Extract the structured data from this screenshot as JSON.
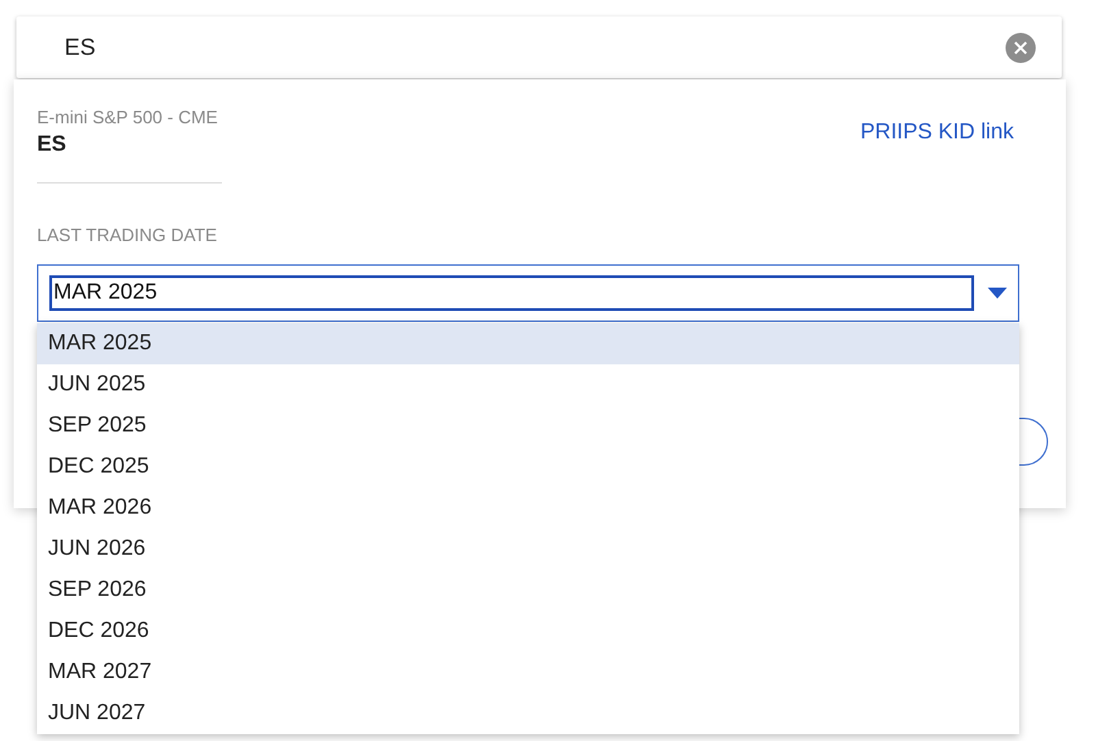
{
  "search": {
    "value": "ES"
  },
  "instrument": {
    "name": "E-mini S&P 500 - CME",
    "symbol": "ES",
    "link": "PRIIPS KID link"
  },
  "last_trading_date": {
    "label": "LAST TRADING DATE",
    "value": "MAR 2025",
    "expanded": true,
    "options": [
      {
        "label": "MAR 2025",
        "selected": true
      },
      {
        "label": "JUN 2025",
        "selected": false
      },
      {
        "label": "SEP 2025",
        "selected": false
      },
      {
        "label": "DEC 2025",
        "selected": false
      },
      {
        "label": "MAR 2026",
        "selected": false
      },
      {
        "label": "JUN 2026",
        "selected": false
      },
      {
        "label": "SEP 2026",
        "selected": false
      },
      {
        "label": "DEC 2026",
        "selected": false
      },
      {
        "label": "MAR 2027",
        "selected": false
      },
      {
        "label": "JUN 2027",
        "selected": false
      }
    ]
  }
}
